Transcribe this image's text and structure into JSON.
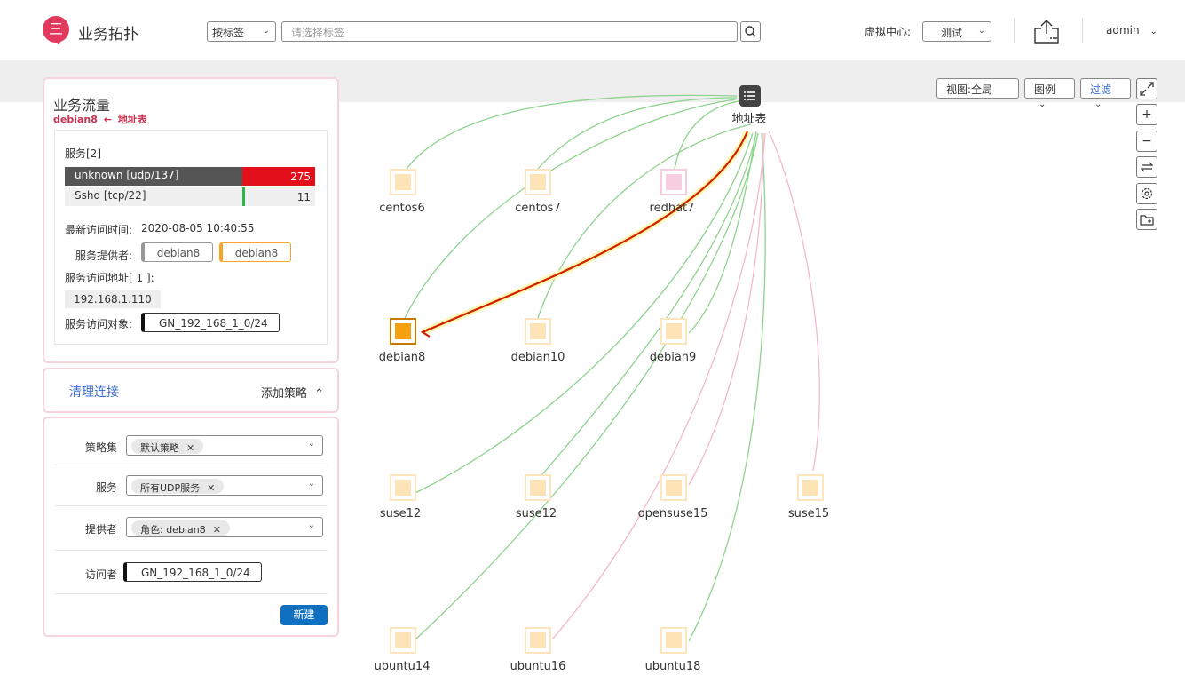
{
  "header": {
    "logo_glyph": "三",
    "app_title": "业务拓扑",
    "tag_select": "按标签",
    "tag_placeholder": "请选择标签",
    "vc_label": "虚拟中心:",
    "vc_value": "测试",
    "user": "admin"
  },
  "flow": {
    "title": "业务流量",
    "source": "debian8",
    "arrow": "←",
    "target": "地址表",
    "services_label": "服务[2]",
    "services": [
      {
        "name": "unknown [udp/137]",
        "count": "275",
        "share": 0.96
      },
      {
        "name": "Sshd [tcp/22]",
        "count": "11",
        "share": 0.04
      }
    ],
    "last_visit_label": "最新访问时间:",
    "last_visit_value": "2020-08-05  10:40:55",
    "provider_label": "服务提供者:",
    "providers": [
      "debian8",
      "debian8"
    ],
    "address_label": "服务访问地址[ 1 ]:",
    "address_value": "192.168.1.110",
    "object_label": "服务访问对象:",
    "object_value": "GN_192_168_1_0/24"
  },
  "actions": {
    "clear_link": "清理连接",
    "add_policy": "添加策略"
  },
  "policy_form": {
    "set_label": "策略集",
    "set_value": "默认策略",
    "service_label": "服务",
    "service_value": "所有UDP服务",
    "provider_label": "提供者",
    "provider_value": "角色: debian8",
    "visitor_label": "访问者",
    "visitor_value": "GN_192_168_1_0/24",
    "new_button": "新建"
  },
  "toolbar": {
    "view_label": "视图:全局",
    "legend_label": "图例",
    "filter_label": "过滤"
  },
  "colors": {
    "accent": "#e23a5c",
    "link_green": "#7fcf7f",
    "link_pink": "#f2b6c8",
    "active_red": "#d11f00",
    "node_orange": "#f5a010"
  },
  "graph": {
    "hub": "地址表",
    "nodes": [
      "centos6",
      "centos7",
      "redhat7",
      "debian8",
      "debian10",
      "debian9",
      "suse12",
      "suse12",
      "opensuse15",
      "suse15",
      "ubuntu14",
      "ubuntu16",
      "ubuntu18"
    ]
  }
}
